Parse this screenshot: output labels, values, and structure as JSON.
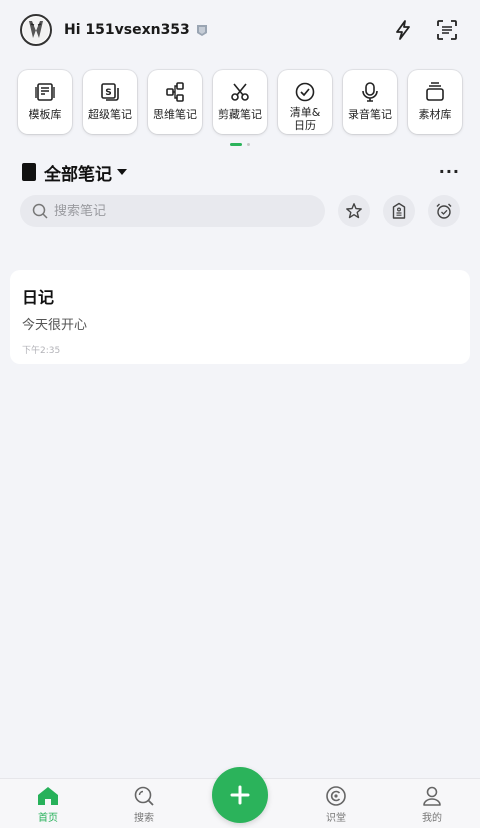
{
  "header": {
    "greeting": "Hi 151vsexn353",
    "avatar_icon": "profile-avatar",
    "actions": [
      "lightning-icon",
      "scan-icon"
    ]
  },
  "tiles": [
    {
      "label": "模板库",
      "icon": "template-icon"
    },
    {
      "label": "超级笔记",
      "icon": "super-note-icon"
    },
    {
      "label": "思维笔记",
      "icon": "mindmap-icon"
    },
    {
      "label": "剪藏笔记",
      "icon": "scissors-icon"
    },
    {
      "label": "清单&日历",
      "icon": "checklist-icon"
    },
    {
      "label": "录音笔记",
      "icon": "microphone-icon"
    },
    {
      "label": "素材库",
      "icon": "material-icon"
    }
  ],
  "section": {
    "title": "全部笔记",
    "more": "···"
  },
  "search": {
    "placeholder": "搜索笔记"
  },
  "notes": [
    {
      "title": "日记",
      "body": "今天很开心",
      "time": "下午2:35"
    }
  ],
  "bottom_nav": {
    "home": "首页",
    "search": "搜索",
    "learn": "识堂",
    "mine": "我的"
  },
  "colors": {
    "accent": "#2bb35b",
    "background": "#f3f4f8",
    "card": "#ffffff"
  }
}
